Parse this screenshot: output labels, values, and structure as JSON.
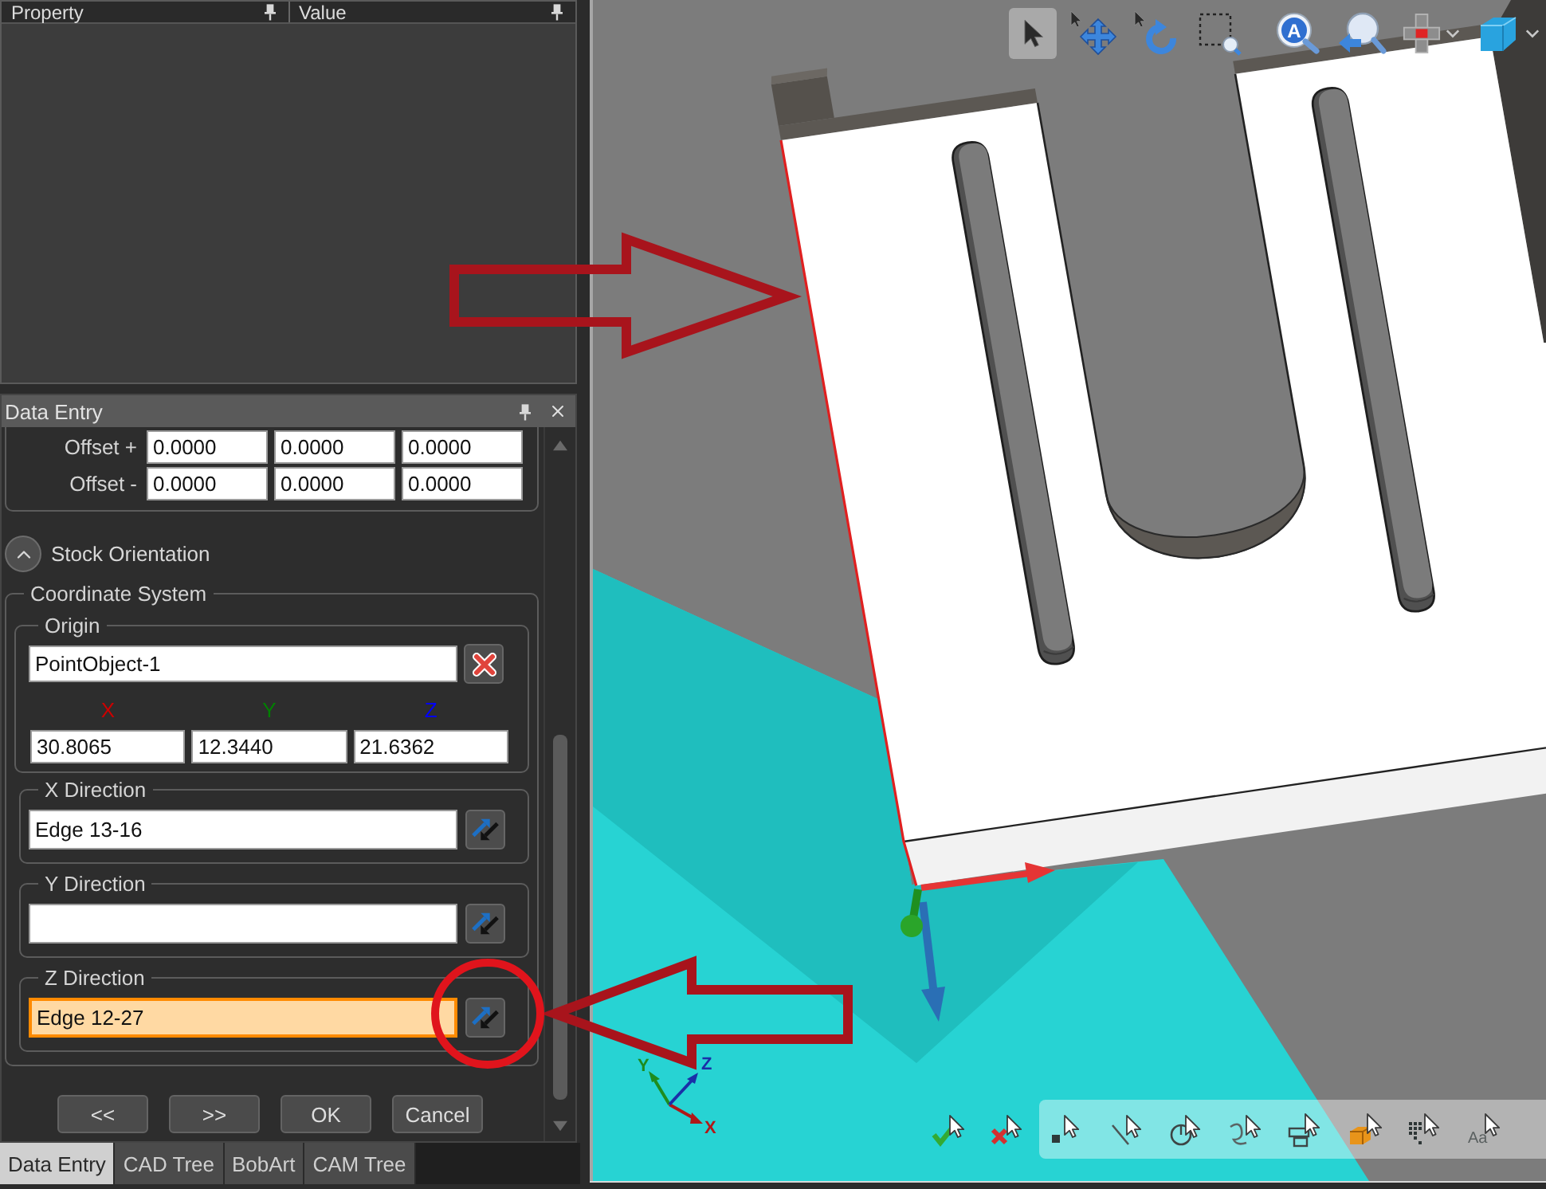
{
  "property_grid": {
    "columns": [
      {
        "label": "Property"
      },
      {
        "label": "Value"
      }
    ]
  },
  "data_entry": {
    "title": "Data Entry",
    "offsets": [
      {
        "label": "Offset +",
        "values": [
          "0.0000",
          "0.0000",
          "0.0000"
        ]
      },
      {
        "label": "Offset -",
        "values": [
          "0.0000",
          "0.0000",
          "0.0000"
        ]
      }
    ],
    "section": {
      "title": "Stock Orientation",
      "expanded": true
    },
    "coordinate_system": {
      "title": "Coordinate System",
      "origin": {
        "title": "Origin",
        "value": "PointObject-1",
        "components": [
          {
            "axis": "X",
            "color": "#cc0000",
            "value": "30.8065"
          },
          {
            "axis": "Y",
            "color": "#008000",
            "value": "12.3440"
          },
          {
            "axis": "Z",
            "color": "#0000ff",
            "value": "21.6362"
          }
        ]
      },
      "directions": [
        {
          "title": "X Direction",
          "value": "Edge 13-16",
          "active": false
        },
        {
          "title": "Y Direction",
          "active": false
        },
        {
          "title": "Z Direction",
          "value": "Edge 12-27",
          "active": true
        }
      ]
    },
    "buttons": [
      "<<",
      ">>",
      "OK",
      "Cancel"
    ]
  },
  "panel_tabs": [
    {
      "label": "Data Entry",
      "selected": true
    },
    {
      "label": "CAD Tree",
      "selected": false
    },
    {
      "label": "BobArt",
      "selected": false
    },
    {
      "label": "CAM Tree",
      "selected": false
    }
  ],
  "viewport": {
    "view_toolbar": [
      {
        "kind": "select",
        "selected": true
      },
      {
        "kind": "pan",
        "selected": false
      },
      {
        "kind": "rotate",
        "selected": false
      },
      {
        "kind": "zoomwindow",
        "selected": false
      },
      {
        "kind": "zoomall",
        "glyph": "A",
        "selected": false
      },
      {
        "kind": "zoomprevious",
        "selected": false
      },
      {
        "kind": "viewwidget",
        "selected": false
      },
      {
        "kind": "cube",
        "selected": false
      }
    ],
    "selection_toolbar": {
      "actions": [
        {
          "kind": "accept"
        },
        {
          "kind": "reject"
        }
      ],
      "filters": [
        {
          "kind": "point"
        },
        {
          "kind": "edge"
        },
        {
          "kind": "circle"
        },
        {
          "kind": "curve"
        },
        {
          "kind": "face"
        },
        {
          "kind": "solid"
        },
        {
          "kind": "points"
        },
        {
          "kind": "text",
          "glyph": "Aa"
        }
      ]
    },
    "axis_triad": [
      {
        "label": "X",
        "color": "#b01818"
      },
      {
        "label": "Y",
        "color": "#1e8c1e"
      },
      {
        "label": "Z",
        "color": "#1a2fa8"
      }
    ]
  }
}
